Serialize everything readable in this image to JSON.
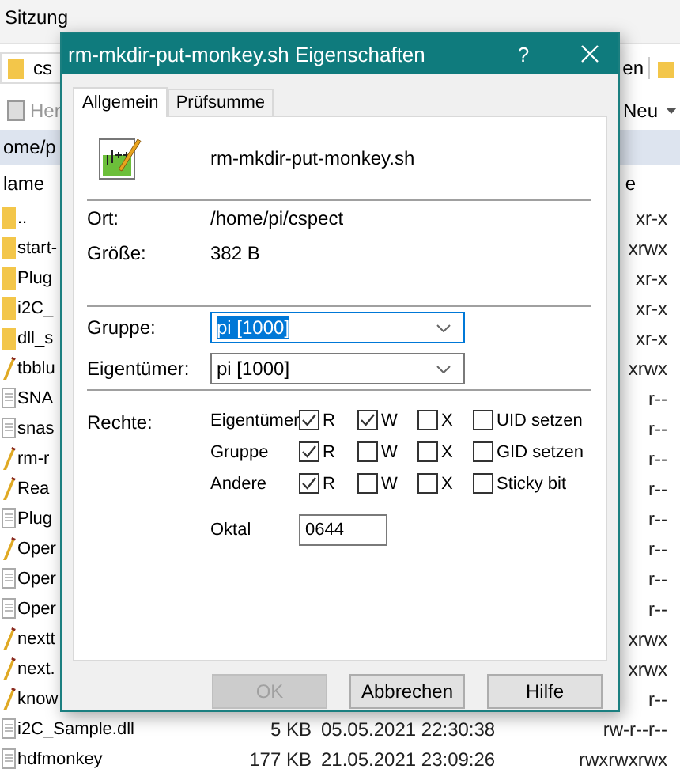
{
  "explorer": {
    "menu_item": "Sitzung",
    "location": "cs",
    "toolbar_button": "en",
    "action": {
      "label": "Her",
      "disabled": true
    },
    "new_button": "Neu",
    "path": "ome/p",
    "columns": [
      "lame",
      "e"
    ],
    "rows": [
      {
        "kind": "folder",
        "name": "..",
        "perms": "xr-x"
      },
      {
        "kind": "folder",
        "name": "start-",
        "perms": "xrwx"
      },
      {
        "kind": "folder",
        "name": "Plug",
        "perms": "xr-x"
      },
      {
        "kind": "folder",
        "name": "i2C_",
        "perms": "xr-x"
      },
      {
        "kind": "folder",
        "name": "dll_s",
        "perms": "xr-x"
      },
      {
        "kind": "script",
        "name": "tbblu",
        "perms": "xrwx"
      },
      {
        "kind": "document",
        "name": "SNA",
        "perms": "r--"
      },
      {
        "kind": "document",
        "name": "snas",
        "perms": "r--"
      },
      {
        "kind": "script",
        "name": "rm-r",
        "perms": "r--"
      },
      {
        "kind": "script",
        "name": "Rea",
        "perms": "r--"
      },
      {
        "kind": "document",
        "name": "Plug",
        "perms": "r--"
      },
      {
        "kind": "script",
        "name": "Oper",
        "perms": "r--"
      },
      {
        "kind": "document",
        "name": "Oper",
        "perms": "r--"
      },
      {
        "kind": "document",
        "name": "Oper",
        "perms": "r--"
      },
      {
        "kind": "script",
        "name": "nextt",
        "perms": "xrwx"
      },
      {
        "kind": "script",
        "name": "next.",
        "perms": "xrwx"
      },
      {
        "kind": "script",
        "name": "know",
        "perms": "r--"
      },
      {
        "kind": "document",
        "name": "i2C_Sample.dll",
        "size": "5 KB",
        "date": "05.05.2021 22:30:38",
        "perms": "rw-r--r--"
      },
      {
        "kind": "document",
        "name": "hdfmonkey",
        "size": "177 KB",
        "date": "21.05.2021 23:09:26",
        "perms": "rwxrwxrwx"
      }
    ]
  },
  "dialog": {
    "title": "rm-mkdir-put-monkey.sh Eigenschaften",
    "help": "?",
    "tabs": [
      {
        "label": "Allgemein",
        "selected": true
      },
      {
        "label": "Prüfsumme",
        "selected": false
      }
    ],
    "file_name": "rm-mkdir-put-monkey.sh",
    "info": [
      {
        "label": "Ort:",
        "value": "/home/pi/cspect"
      },
      {
        "label": "Größe:",
        "value": "382 B"
      }
    ],
    "combos": [
      {
        "label": "Gruppe:",
        "value": "pi [1000]",
        "focused": true
      },
      {
        "label": "Eigentümer:",
        "value": "pi [1000]",
        "focused": false
      }
    ],
    "rights": {
      "label": "Rechte:",
      "rows": [
        {
          "label": "Eigentümer",
          "bits": [
            {
              "label": "R",
              "checked": true
            },
            {
              "label": "W",
              "checked": true
            },
            {
              "label": "X",
              "checked": false
            }
          ],
          "special": {
            "label": "UID setzen",
            "checked": false
          }
        },
        {
          "label": "Gruppe",
          "bits": [
            {
              "label": "R",
              "checked": true
            },
            {
              "label": "W",
              "checked": false
            },
            {
              "label": "X",
              "checked": false
            }
          ],
          "special": {
            "label": "GID setzen",
            "checked": false
          }
        },
        {
          "label": "Andere",
          "bits": [
            {
              "label": "R",
              "checked": true
            },
            {
              "label": "W",
              "checked": false
            },
            {
              "label": "X",
              "checked": false
            }
          ],
          "special": {
            "label": "Sticky bit",
            "checked": false
          }
        }
      ],
      "octal": {
        "label": "Oktal",
        "value": "0644"
      }
    },
    "buttons": [
      {
        "label": "OK",
        "disabled": true
      },
      {
        "label": "Abbrechen",
        "disabled": false
      },
      {
        "label": "Hilfe",
        "disabled": false
      }
    ]
  }
}
